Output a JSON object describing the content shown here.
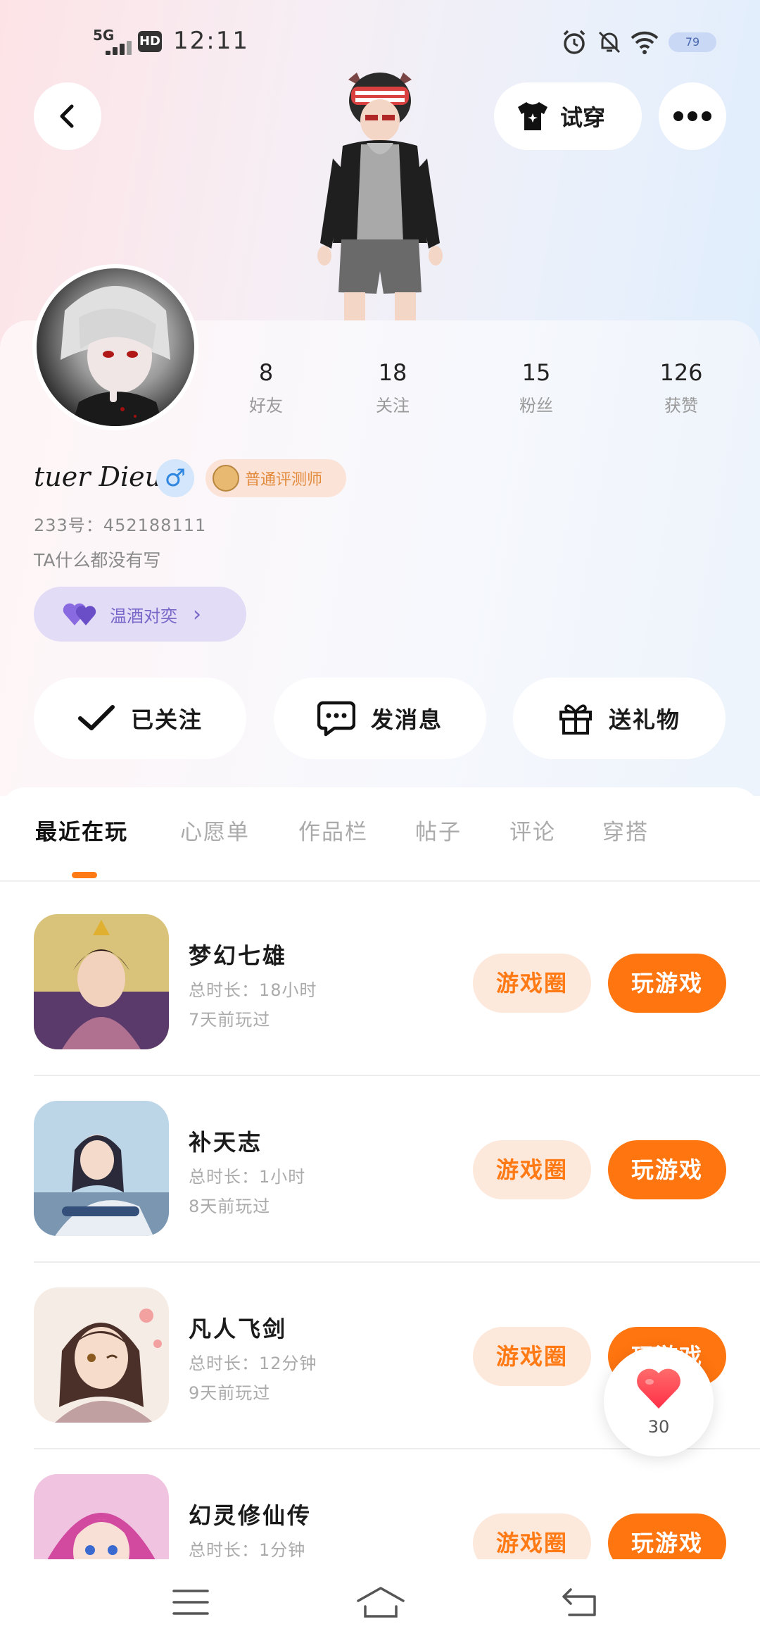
{
  "status_bar": {
    "network": "5G",
    "hd": "HD",
    "time": "12:11",
    "battery": "79"
  },
  "header": {
    "try_on_label": "试穿"
  },
  "profile": {
    "stats": [
      {
        "num": "8",
        "label": "好友"
      },
      {
        "num": "18",
        "label": "关注"
      },
      {
        "num": "15",
        "label": "粉丝"
      },
      {
        "num": "126",
        "label": "获赞"
      }
    ],
    "username": "tuer Dieu.",
    "gender_symbol": "♂",
    "badge": "普通评测师",
    "uid": "233号：452188111",
    "bio": "TA什么都没有写",
    "duo_label": "温酒对奕",
    "chevron": "›"
  },
  "actions": {
    "follow": "已关注",
    "message": "发消息",
    "gift": "送礼物"
  },
  "tabs": [
    "最近在玩",
    "心愿单",
    "作品栏",
    "帖子",
    "评论",
    "穿搭"
  ],
  "games": [
    {
      "name": "梦幻七雄",
      "time": "总时长：18小时",
      "ago": "7天前玩过",
      "circle": "游戏圈",
      "play": "玩游戏"
    },
    {
      "name": "补天志",
      "time": "总时长：1小时",
      "ago": "8天前玩过",
      "circle": "游戏圈",
      "play": "玩游戏"
    },
    {
      "name": "凡人飞剑",
      "time": "总时长：12分钟",
      "ago": "9天前玩过",
      "circle": "游戏圈",
      "play": "玩游戏"
    },
    {
      "name": "幻灵修仙传",
      "time": "总时长：1分钟",
      "ago": "",
      "circle": "游戏圈",
      "play": "玩游戏"
    }
  ],
  "like": {
    "count": "30"
  },
  "colors": {
    "accent": "#ff7510",
    "accent_light": "#fde8dc",
    "duo_bg": "#e3dcf7",
    "gender_blue": "#2f86e0"
  },
  "icons": [
    "back-arrow-icon",
    "tshirt-icon",
    "more-dots-icon",
    "checkmark-icon",
    "chat-bubble-icon",
    "gift-icon",
    "heart-icon",
    "menu-icon",
    "home-icon",
    "return-icon"
  ]
}
